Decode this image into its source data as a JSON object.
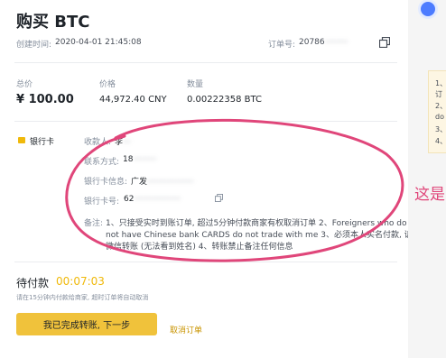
{
  "order": {
    "title": "购买 BTC",
    "created_label": "创建时间:",
    "created_value": "2020-04-01 21:45:08",
    "order_no_label": "订单号:",
    "order_no_value": "20786"
  },
  "summary": {
    "total_label": "总价",
    "total_value": "¥ 100.00",
    "price_label": "价格",
    "price_value": "44,972.40 CNY",
    "qty_label": "数量",
    "qty_value": "0.00222358 BTC"
  },
  "payment": {
    "method_label": "银行卡",
    "payee_label": "收款人:",
    "payee_value": "李",
    "contact_label": "联系方式:",
    "contact_value": "18",
    "bank_info_label": "银行卡信息:",
    "bank_info_value": "广发",
    "card_no_label": "银行卡号:",
    "card_no_value": "62",
    "remark_label": "备注:",
    "remark_lines": [
      "1、只接受实时到账订单, 超过5分钟付款商家有权取消订单 2、Foreigners who do",
      "not have Chinese bank CARDS do not trade with me 3、必须本人实名付款, 请勿",
      "微信转账 (无法看到姓名) 4、转账禁止备注任何信息"
    ]
  },
  "pending": {
    "label": "待付款",
    "countdown": "00:07:03",
    "hint": "请在15分钟内付款给商家, 超时订单将自动取消"
  },
  "actions": {
    "done_button": "我已完成转账, 下一步",
    "cancel_link": "取消订单"
  },
  "side_panel": {
    "lines": [
      "1、",
      "订",
      "2、",
      "do",
      "3、",
      "4、"
    ],
    "overlay_text": "这是"
  },
  "colors": {
    "accent": "#f0b90b",
    "countdown": "#f0b90b",
    "annotation": "#e0467a"
  }
}
